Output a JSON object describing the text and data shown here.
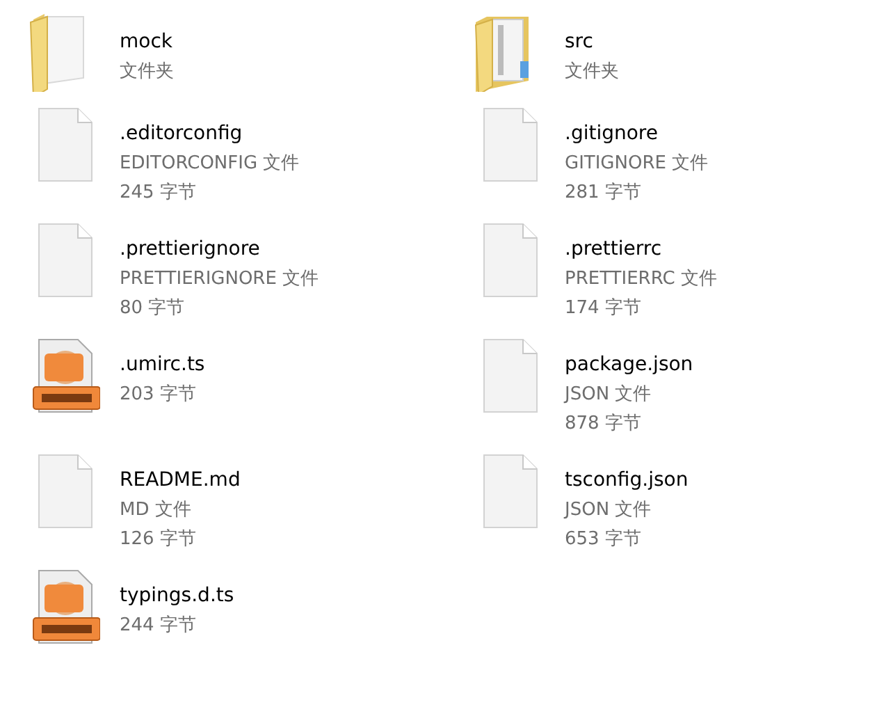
{
  "items": [
    {
      "kind": "folder",
      "name": "mock",
      "type": "文件夹"
    },
    {
      "kind": "folder-full",
      "name": "src",
      "type": "文件夹"
    },
    {
      "kind": "file",
      "name": ".editorconfig",
      "type": "EDITORCONFIG 文件",
      "size": "245 字节"
    },
    {
      "kind": "file",
      "name": ".gitignore",
      "type": "GITIGNORE 文件",
      "size": "281 字节"
    },
    {
      "kind": "file",
      "name": ".prettierignore",
      "type": "PRETTIERIGNORE 文件",
      "size": "80 字节"
    },
    {
      "kind": "file",
      "name": ".prettierrc",
      "type": "PRETTIERRC 文件",
      "size": "174 字节"
    },
    {
      "kind": "video",
      "name": ".umirc.ts",
      "size": "203 字节"
    },
    {
      "kind": "file",
      "name": "package.json",
      "type": "JSON 文件",
      "size": "878 字节"
    },
    {
      "kind": "file",
      "name": "README.md",
      "type": "MD 文件",
      "size": "126 字节"
    },
    {
      "kind": "file",
      "name": "tsconfig.json",
      "type": "JSON 文件",
      "size": "653 字节"
    },
    {
      "kind": "video",
      "name": "typings.d.ts",
      "size": "244 字节"
    }
  ]
}
